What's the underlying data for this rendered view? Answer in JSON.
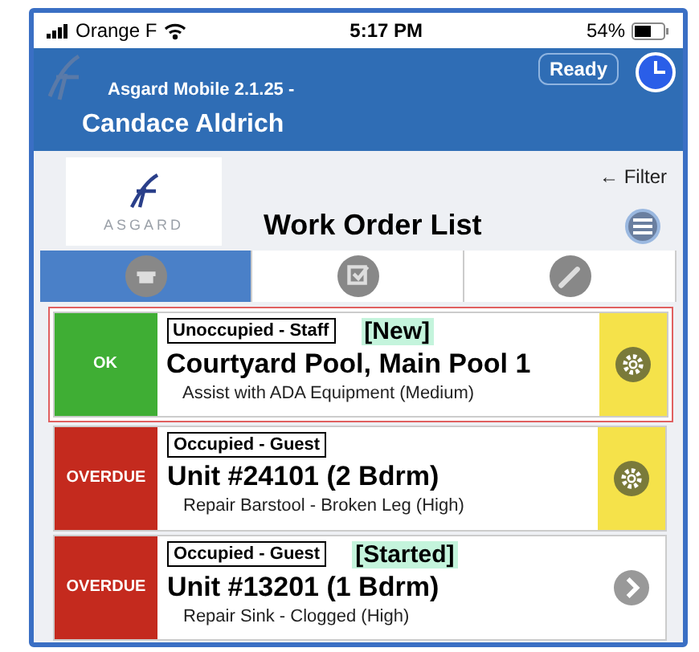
{
  "status_bar": {
    "carrier": "Orange F",
    "time": "5:17 PM",
    "battery": "54%"
  },
  "header": {
    "app": "Asgard Mobile 2.1.25 -",
    "user": "Candace Aldrich",
    "ready_button": "Ready"
  },
  "logo": {
    "text": "ASGARD"
  },
  "title": "Work Order List",
  "filter_hint": "← Filter",
  "tabs": [
    {
      "selected": true
    },
    {
      "selected": false
    },
    {
      "selected": false
    }
  ],
  "work_orders": [
    {
      "status": "OK",
      "color": "#3fae34",
      "occupancy": "Unoccupied - Staff",
      "tag": "[New]",
      "location": "Courtyard Pool, Main Pool 1",
      "task": "Assist with ADA Equipment (Medium)",
      "kind": "settings",
      "highlighted": true
    },
    {
      "status": "OVERDUE",
      "color": "#c42a1e",
      "occupancy": "Occupied - Guest",
      "location": "Unit #24101 (2 Bdrm)",
      "task": "Repair Barstool - Broken Leg (High)",
      "kind": "settings",
      "highlighted": false
    },
    {
      "status": "OVERDUE",
      "color": "#c42a1e",
      "occupancy": "Occupied - Guest",
      "tag": "[Started]",
      "location": "Unit #13201 (1 Bdrm)",
      "task": "Repair Sink - Clogged (High)",
      "kind": "open",
      "highlighted": false
    }
  ]
}
